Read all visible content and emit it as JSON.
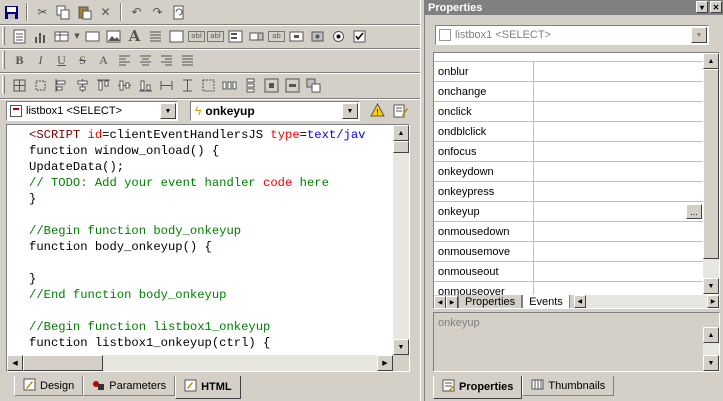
{
  "left": {
    "object_combo": "listbox1 <SELECT>",
    "event_combo": "onkeyup",
    "code_lines": [
      [
        {
          "t": "<SCRIPT ",
          "c": "kw-tag"
        },
        {
          "t": "id",
          "c": "kw-attr"
        },
        {
          "t": "=clientEventHandlersJS ",
          "c": ""
        },
        {
          "t": "type",
          "c": "kw-attr"
        },
        {
          "t": "=",
          "c": ""
        },
        {
          "t": "text/jav",
          "c": "kw-val"
        }
      ],
      [
        {
          "t": "function window_onload() {",
          "c": ""
        }
      ],
      [
        {
          "t": "UpdateData();",
          "c": ""
        }
      ],
      [
        {
          "t": "// TODO: Add your event handler ",
          "c": "cm"
        },
        {
          "t": "code",
          "c": "cm-red"
        },
        {
          "t": " here",
          "c": "cm"
        }
      ],
      [
        {
          "t": "}",
          "c": ""
        }
      ],
      [
        {
          "t": "",
          "c": ""
        }
      ],
      [
        {
          "t": "//Begin function body_onkeyup",
          "c": "cm"
        }
      ],
      [
        {
          "t": "function body_onkeyup() {",
          "c": ""
        }
      ],
      [
        {
          "t": "",
          "c": ""
        }
      ],
      [
        {
          "t": "}",
          "c": ""
        }
      ],
      [
        {
          "t": "//End function body_onkeyup",
          "c": "cm"
        }
      ],
      [
        {
          "t": "",
          "c": ""
        }
      ],
      [
        {
          "t": "//Begin function listbox1_onkeyup",
          "c": "cm"
        }
      ],
      [
        {
          "t": "function listbox1_onkeyup(ctrl) {",
          "c": ""
        }
      ]
    ],
    "tabs": [
      {
        "label": "Design",
        "icon": "design-icon",
        "active": false
      },
      {
        "label": "Parameters",
        "icon": "parameters-icon",
        "active": false
      },
      {
        "label": "HTML",
        "icon": "html-icon",
        "active": true
      }
    ]
  },
  "right": {
    "title": "Properties",
    "object_combo": "listbox1 <SELECT>",
    "properties": [
      {
        "name": "onblur",
        "value": ""
      },
      {
        "name": "onchange",
        "value": ""
      },
      {
        "name": "onclick",
        "value": ""
      },
      {
        "name": "ondblclick",
        "value": ""
      },
      {
        "name": "onfocus",
        "value": ""
      },
      {
        "name": "onkeydown",
        "value": ""
      },
      {
        "name": "onkeypress",
        "value": ""
      },
      {
        "name": "onkeyup",
        "value": "",
        "selected": true
      },
      {
        "name": "onmousedown",
        "value": ""
      },
      {
        "name": "onmousemove",
        "value": ""
      },
      {
        "name": "onmouseout",
        "value": ""
      },
      {
        "name": "onmouseover",
        "value": ""
      }
    ],
    "grid_tabs": [
      "Properties",
      "Events"
    ],
    "active_grid_tab": "Events",
    "description": "onkeyup",
    "tabs": [
      {
        "label": "Properties",
        "icon": "properties-icon",
        "active": true
      },
      {
        "label": "Thumbnails",
        "icon": "thumbnails-icon",
        "active": false
      }
    ]
  }
}
